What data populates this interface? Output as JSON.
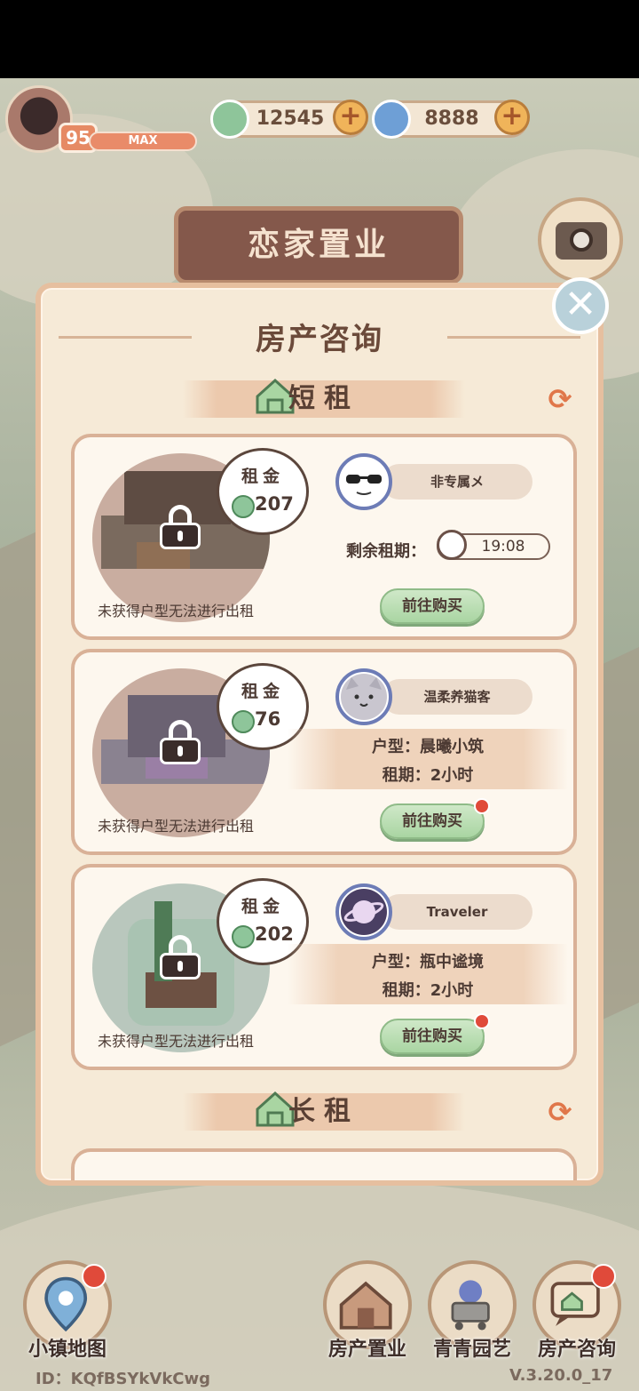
{
  "player": {
    "level": "95",
    "xp_label": "MAX"
  },
  "currency": {
    "clover": "12545",
    "spiral": "8888",
    "plus_glyph": "+"
  },
  "scene": {
    "sign_text": "恋家置业",
    "camera_label": "拍照"
  },
  "panel": {
    "title": "房产咨询",
    "close_glyph": "✕",
    "sections": [
      {
        "label": "短租",
        "refresh_glyph": "⟳"
      },
      {
        "label": "长租",
        "refresh_glyph": "⟳"
      }
    ],
    "cards": [
      {
        "rent_label": "租金",
        "rent": "207",
        "notice": "未获得户型无法进行出租",
        "npc_name": "非专属メ",
        "remain_label": "剩余租期：",
        "timer": "19:08",
        "buy_label": "前往购买",
        "has_red_dot": false
      },
      {
        "rent_label": "租金",
        "rent": "76",
        "notice": "未获得户型无法进行出租",
        "npc_name": "温柔养猫客",
        "type_line": "户型：晨曦小筑",
        "period_line": "租期：2小时",
        "buy_label": "前往购买",
        "has_red_dot": true
      },
      {
        "rent_label": "租金",
        "rent": "202",
        "notice": "未获得户型无法进行出租",
        "npc_name": "Traveler",
        "type_line": "户型：瓶中谧境",
        "period_line": "租期：2小时",
        "buy_label": "前往购买",
        "has_red_dot": true
      }
    ]
  },
  "nav": {
    "items": [
      {
        "label": "小镇地图",
        "icon": "map-pin-icon"
      },
      {
        "label": "房产置业",
        "icon": "house-icon"
      },
      {
        "label": "青青园艺",
        "icon": "flower-cart-icon"
      },
      {
        "label": "房产咨询",
        "icon": "chat-house-icon"
      }
    ]
  },
  "footer": {
    "player_id": "ID：KQfBSYkVkCwg",
    "version": "V.3.20.0_17"
  },
  "colors": {
    "panel_bg": "#f6ead7",
    "panel_border": "#e6bf9f",
    "buy_green": "#a9d5a2",
    "accent_orange": "#e0774a"
  }
}
